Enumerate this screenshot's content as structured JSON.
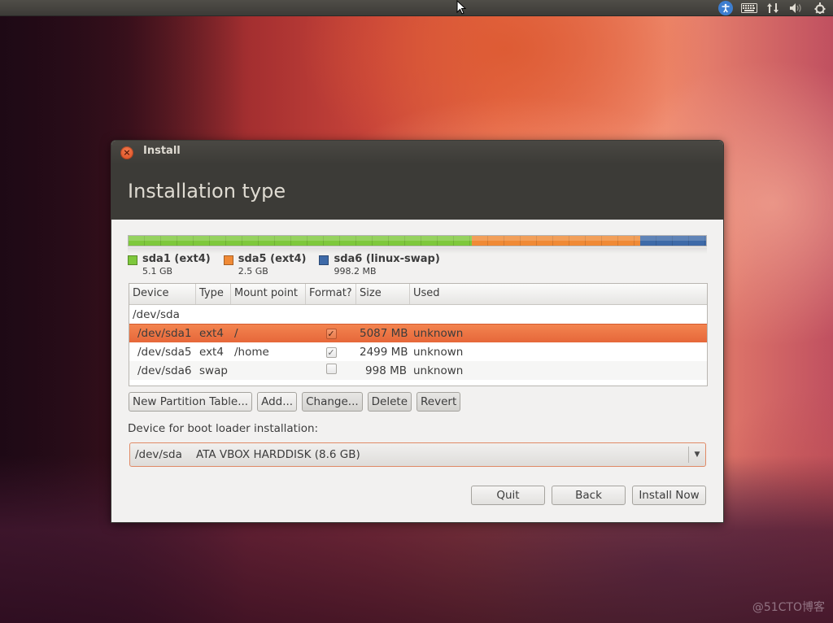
{
  "top_panel": {
    "tray_icons": [
      "accessibility-icon",
      "keyboard-icon",
      "network-icon",
      "volume-icon",
      "power-gear-icon"
    ]
  },
  "window": {
    "title": "Install",
    "page_title": "Installation type"
  },
  "partition_bar": {
    "segments": [
      {
        "name": "sda1 (ext4)",
        "size": "5.1 GB",
        "color": "#7ec83c",
        "share": 0.594
      },
      {
        "name": "sda5 (ext4)",
        "size": "2.5 GB",
        "color": "#f08a36",
        "share": 0.292
      },
      {
        "name": "sda6 (linux-swap)",
        "size": "998.2 MB",
        "color": "#3e6aa8",
        "share": 0.114
      }
    ]
  },
  "table": {
    "headers": [
      "Device",
      "Type",
      "Mount point",
      "Format?",
      "Size",
      "Used"
    ],
    "disk_row": "/dev/sda",
    "rows": [
      {
        "device": "/dev/sda1",
        "type": "ext4",
        "mount": "/",
        "format": true,
        "size": "5087 MB",
        "used": "unknown",
        "selected": true
      },
      {
        "device": "/dev/sda5",
        "type": "ext4",
        "mount": "/home",
        "format": true,
        "size": "2499 MB",
        "used": "unknown",
        "selected": false
      },
      {
        "device": "/dev/sda6",
        "type": "swap",
        "mount": "",
        "format": false,
        "size": "998 MB",
        "used": "unknown",
        "selected": false
      }
    ]
  },
  "actions": {
    "new_partition_table": "New Partition Table...",
    "add": "Add...",
    "change": "Change...",
    "delete": "Delete",
    "revert": "Revert"
  },
  "boot_loader": {
    "label": "Device for boot loader installation:",
    "selected": "/dev/sda    ATA VBOX HARDDISK (8.6 GB)"
  },
  "nav": {
    "quit": "Quit",
    "back": "Back",
    "install_now": "Install Now"
  },
  "colors": {
    "accent": "#e6673a",
    "header_bg": "#3c3b37"
  },
  "watermark": "@51CTO博客"
}
